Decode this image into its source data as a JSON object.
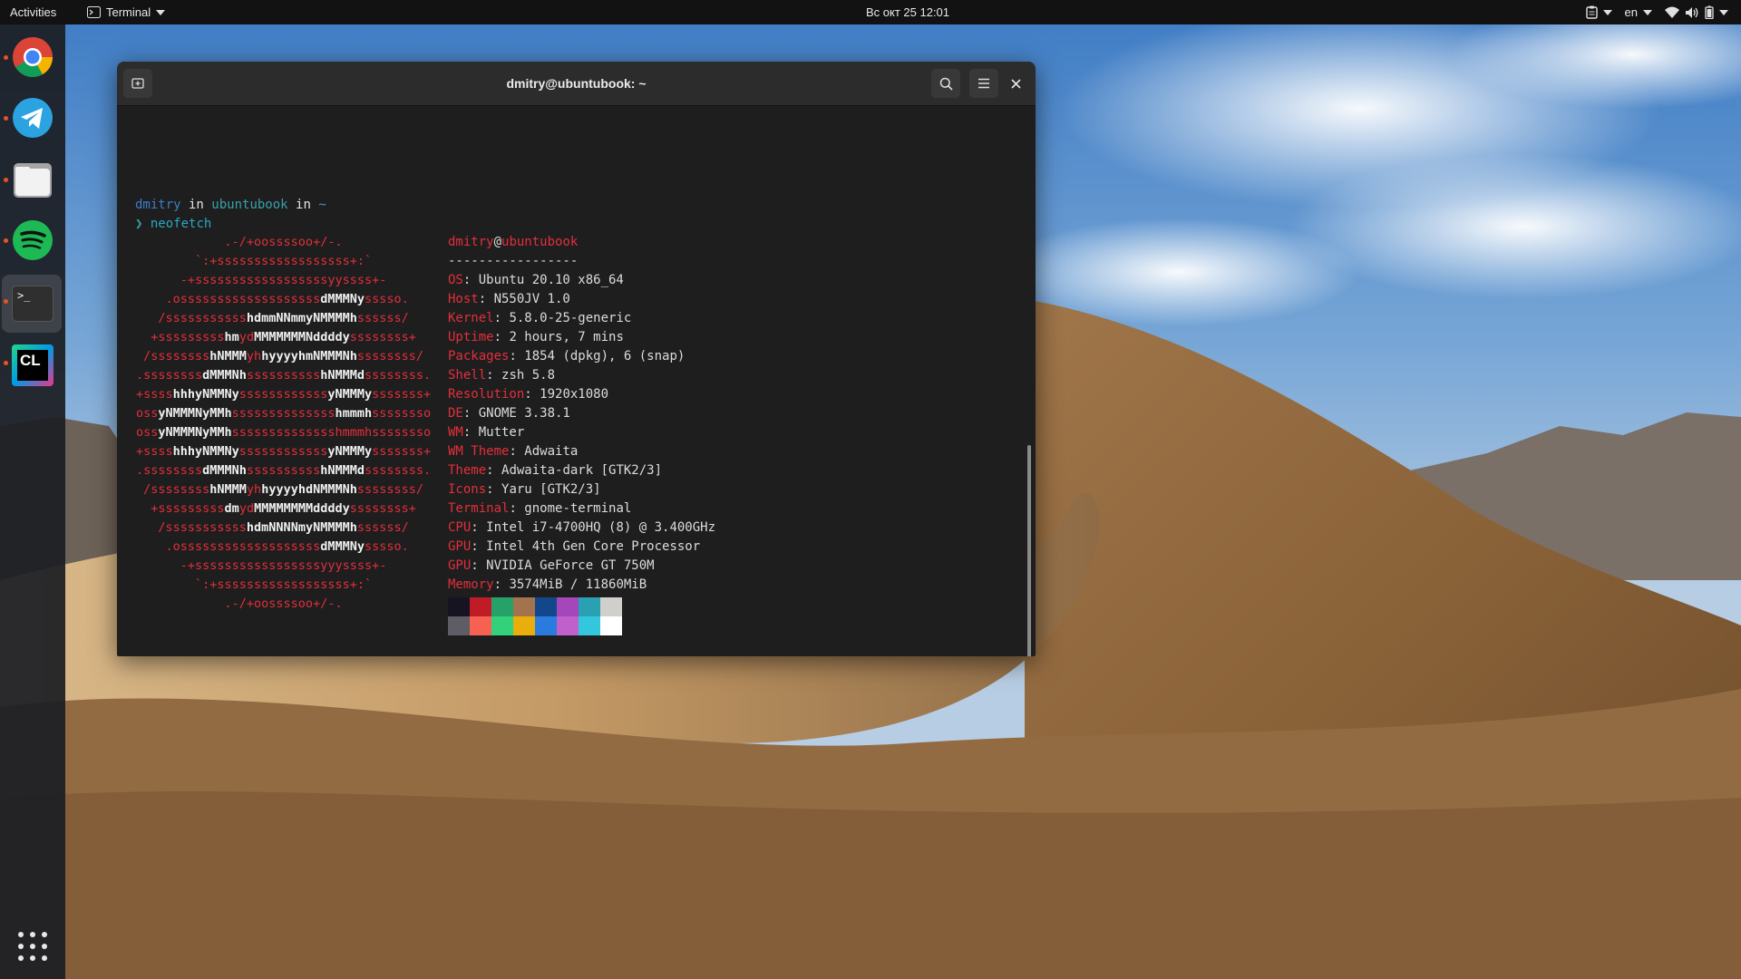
{
  "topbar": {
    "activities": "Activities",
    "app_name": "Terminal",
    "clock": "Вс окт 25  12:01",
    "lang": "en"
  },
  "dock": {
    "items": [
      {
        "name": "Google Chrome",
        "icon": "chrome-icon"
      },
      {
        "name": "Telegram",
        "icon": "telegram-icon"
      },
      {
        "name": "Files",
        "icon": "files-icon"
      },
      {
        "name": "Spotify",
        "icon": "spotify-icon"
      },
      {
        "name": "Terminal",
        "icon": "terminal-icon",
        "label": ">_"
      },
      {
        "name": "CLion",
        "icon": "clion-icon",
        "label": "CL"
      }
    ],
    "apps_grid_icon": "apps-grid-icon"
  },
  "terminal": {
    "title": "dmitry@ubuntubook: ~",
    "prompt": {
      "user": "dmitry",
      "sep1": " in ",
      "host": "ubuntubook",
      "sep2": " in ",
      "dir": "~",
      "arrow": "❯",
      "command": "neofetch"
    },
    "neofetch": {
      "header_user": "dmitry",
      "header_at": "@",
      "header_host": "ubuntubook",
      "separator": "-----------------",
      "fields": [
        {
          "key": "OS",
          "value": "Ubuntu 20.10 x86_64"
        },
        {
          "key": "Host",
          "value": "N550JV 1.0"
        },
        {
          "key": "Kernel",
          "value": "5.8.0-25-generic"
        },
        {
          "key": "Uptime",
          "value": "2 hours, 7 mins"
        },
        {
          "key": "Packages",
          "value": "1854 (dpkg), 6 (snap)"
        },
        {
          "key": "Shell",
          "value": "zsh 5.8"
        },
        {
          "key": "Resolution",
          "value": "1920x1080"
        },
        {
          "key": "DE",
          "value": "GNOME 3.38.1"
        },
        {
          "key": "WM",
          "value": "Mutter"
        },
        {
          "key": "WM Theme",
          "value": "Adwaita"
        },
        {
          "key": "Theme",
          "value": "Adwaita-dark [GTK2/3]"
        },
        {
          "key": "Icons",
          "value": "Yaru [GTK2/3]"
        },
        {
          "key": "Terminal",
          "value": "gnome-terminal"
        },
        {
          "key": "CPU",
          "value": "Intel i7-4700HQ (8) @ 3.400GHz"
        },
        {
          "key": "GPU",
          "value": "Intel 4th Gen Core Processor"
        },
        {
          "key": "GPU",
          "value": "NVIDIA GeForce GT 750M"
        },
        {
          "key": "Memory",
          "value": "3574MiB / 11860MiB"
        }
      ],
      "logo": [
        [
          [
            "r",
            "            .-/+oossssoo+/-."
          ]
        ],
        [
          [
            "r",
            "        `:+ssssssssssssssssss+:`"
          ]
        ],
        [
          [
            "r",
            "      -+ssssssssssssssssssyyssss+-"
          ]
        ],
        [
          [
            "r",
            "    .osssssssssssssssssss"
          ],
          [
            "w",
            "dMMMNy"
          ],
          [
            "r",
            "sssso."
          ]
        ],
        [
          [
            "r",
            "   /sssssssssss"
          ],
          [
            "w",
            "hdmmNNmmyNMMMMh"
          ],
          [
            "r",
            "ssssss/"
          ]
        ],
        [
          [
            "r",
            "  +sssssssss"
          ],
          [
            "w",
            "hm"
          ],
          [
            "r",
            "yd"
          ],
          [
            "w",
            "MMMMMMMNddddy"
          ],
          [
            "r",
            "ssssssss+"
          ]
        ],
        [
          [
            "r",
            " /ssssssss"
          ],
          [
            "w",
            "hNMMM"
          ],
          [
            "r",
            "yh"
          ],
          [
            "w",
            "hyyyyhmNMMMNh"
          ],
          [
            "r",
            "ssssssss/"
          ]
        ],
        [
          [
            "r",
            ".ssssssss"
          ],
          [
            "w",
            "dMMMNh"
          ],
          [
            "r",
            "ssssssssss"
          ],
          [
            "w",
            "hNMMMd"
          ],
          [
            "r",
            "ssssssss."
          ]
        ],
        [
          [
            "r",
            "+ssss"
          ],
          [
            "w",
            "hhhyNMMNy"
          ],
          [
            "r",
            "ssssssssssss"
          ],
          [
            "w",
            "yNMMMy"
          ],
          [
            "r",
            "sssssss+"
          ]
        ],
        [
          [
            "r",
            "oss"
          ],
          [
            "w",
            "yNMMMNyMMh"
          ],
          [
            "r",
            "ssssssssssssss"
          ],
          [
            "w",
            "hmmmh"
          ],
          [
            "r",
            "ssssssso"
          ]
        ],
        [
          [
            "r",
            "oss"
          ],
          [
            "w",
            "yNMMMNyMMh"
          ],
          [
            "r",
            "sssssssssssssshmmmhssssssso"
          ]
        ],
        [
          [
            "r",
            "+ssss"
          ],
          [
            "w",
            "hhhyNMMNy"
          ],
          [
            "r",
            "ssssssssssss"
          ],
          [
            "w",
            "yNMMMy"
          ],
          [
            "r",
            "sssssss+"
          ]
        ],
        [
          [
            "r",
            ".ssssssss"
          ],
          [
            "w",
            "dMMMNh"
          ],
          [
            "r",
            "ssssssssss"
          ],
          [
            "w",
            "hNMMMd"
          ],
          [
            "r",
            "ssssssss."
          ]
        ],
        [
          [
            "r",
            " /ssssssss"
          ],
          [
            "w",
            "hNMMM"
          ],
          [
            "r",
            "yh"
          ],
          [
            "w",
            "hyyyyhdNMMMNh"
          ],
          [
            "r",
            "ssssssss/"
          ]
        ],
        [
          [
            "r",
            "  +sssssssss"
          ],
          [
            "w",
            "dm"
          ],
          [
            "r",
            "yd"
          ],
          [
            "w",
            "MMMMMMMMddddy"
          ],
          [
            "r",
            "ssssssss+"
          ]
        ],
        [
          [
            "r",
            "   /sssssssssss"
          ],
          [
            "w",
            "hdmNNNNmyNMMMMh"
          ],
          [
            "r",
            "ssssss/"
          ]
        ],
        [
          [
            "r",
            "    .osssssssssssssssssss"
          ],
          [
            "w",
            "dMMMNy"
          ],
          [
            "r",
            "sssso."
          ]
        ],
        [
          [
            "r",
            "      -+sssssssssssssssssyyyssss+-"
          ]
        ],
        [
          [
            "r",
            "        `:+ssssssssssssssssss+:`"
          ]
        ],
        [
          [
            "r",
            "            .-/+oossssoo+/-."
          ]
        ]
      ],
      "palette_top": [
        "#171421",
        "#c01c28",
        "#26a269",
        "#a2734c",
        "#12488b",
        "#a347ba",
        "#2aa1b3",
        "#d0cfcc"
      ],
      "palette_bottom": [
        "#5e5c64",
        "#f66151",
        "#33d17a",
        "#e9ad0c",
        "#2a7bde",
        "#c061cb",
        "#33c7de",
        "#ffffff"
      ]
    }
  },
  "colors": {
    "accent_red": "#e32f3b",
    "topbar_bg": "#121212",
    "terminal_bg": "#1e1e1e"
  }
}
